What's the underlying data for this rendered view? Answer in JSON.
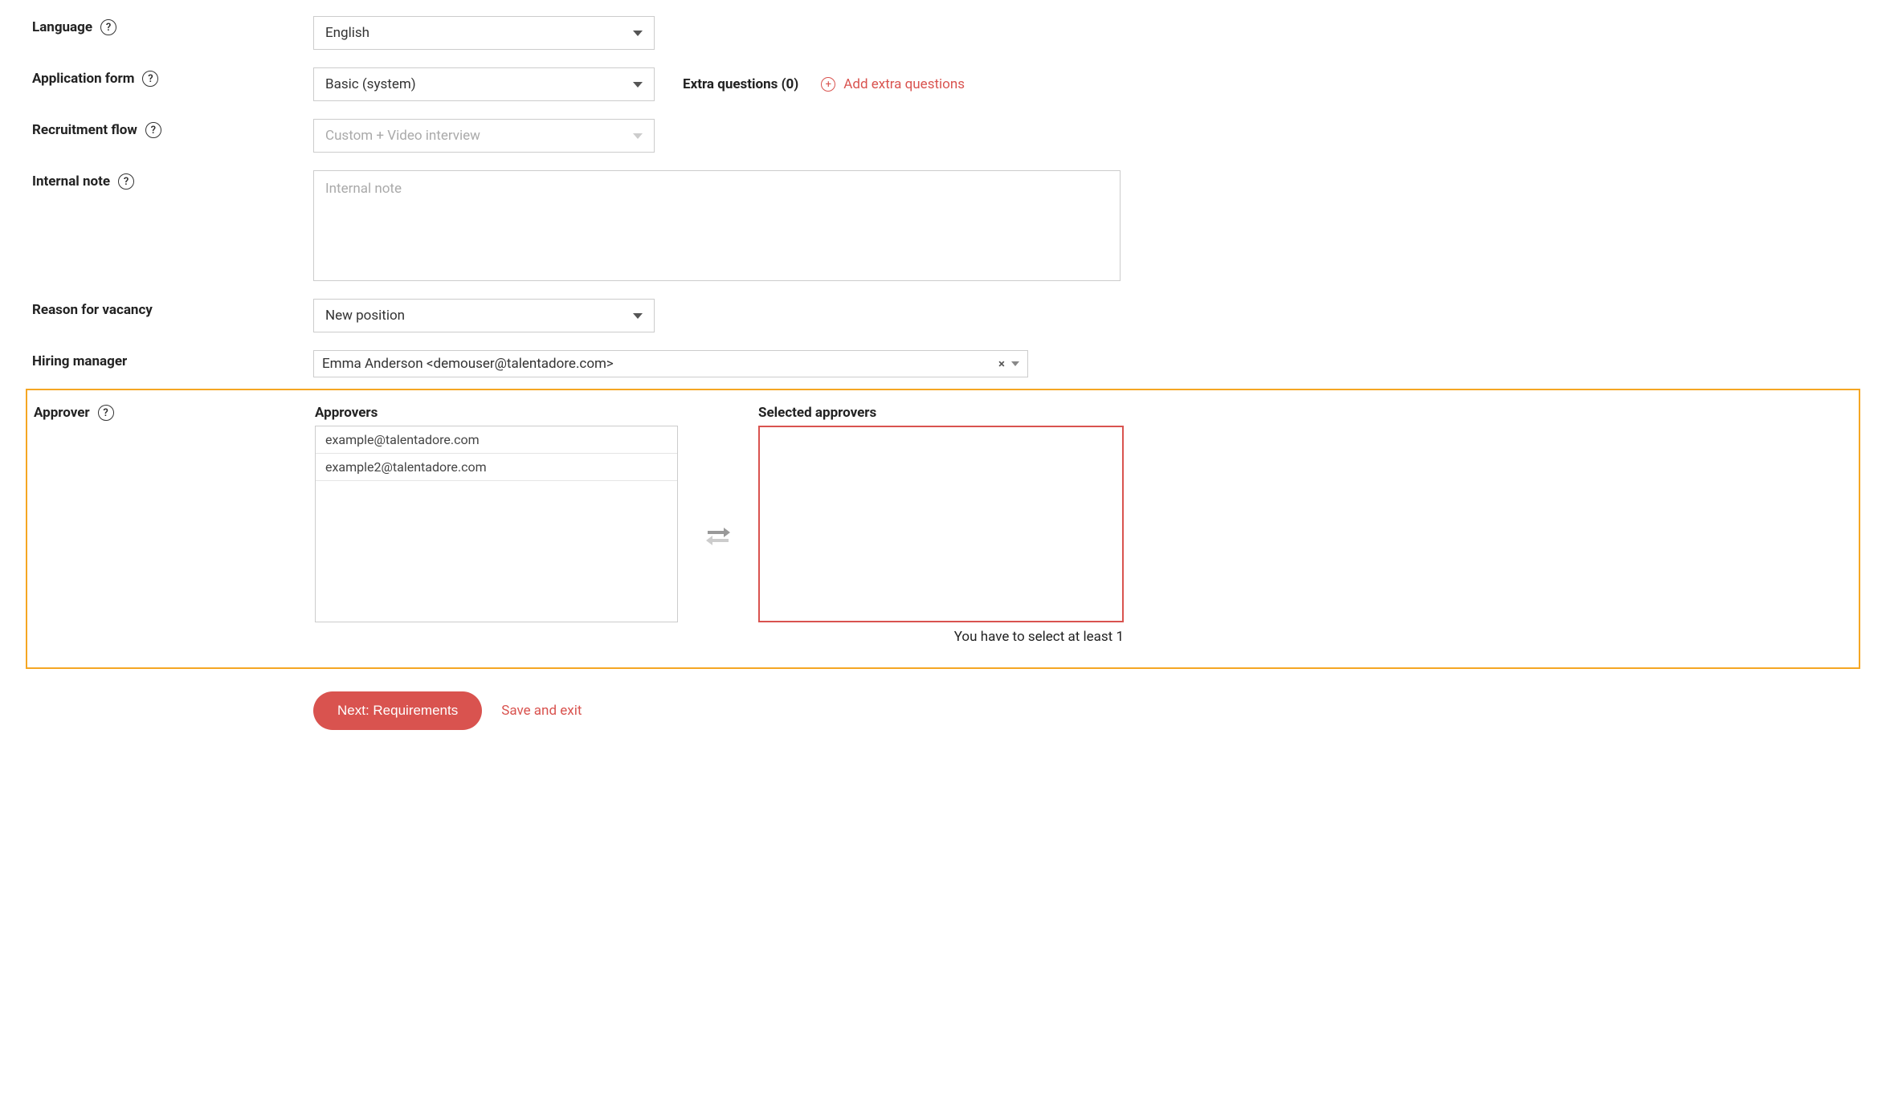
{
  "form": {
    "language": {
      "label": "Language",
      "value": "English"
    },
    "applicationForm": {
      "label": "Application form",
      "value": "Basic (system)"
    },
    "extraQuestions": {
      "label": "Extra questions (0)",
      "addLabel": "Add extra questions"
    },
    "recruitmentFlow": {
      "label": "Recruitment flow",
      "value": "Custom + Video interview"
    },
    "internalNote": {
      "label": "Internal note",
      "placeholder": "Internal note"
    },
    "reasonForVacancy": {
      "label": "Reason for vacancy",
      "value": "New position"
    },
    "hiringManager": {
      "label": "Hiring manager",
      "value": "Emma Anderson <demouser@talentadore.com>"
    },
    "approver": {
      "label": "Approver",
      "availableHeader": "Approvers",
      "selectedHeader": "Selected approvers",
      "available": [
        "example@talentadore.com",
        "example2@talentadore.com"
      ],
      "warning": "You have to select at least 1"
    }
  },
  "buttons": {
    "next": "Next: Requirements",
    "saveExit": "Save and exit"
  }
}
